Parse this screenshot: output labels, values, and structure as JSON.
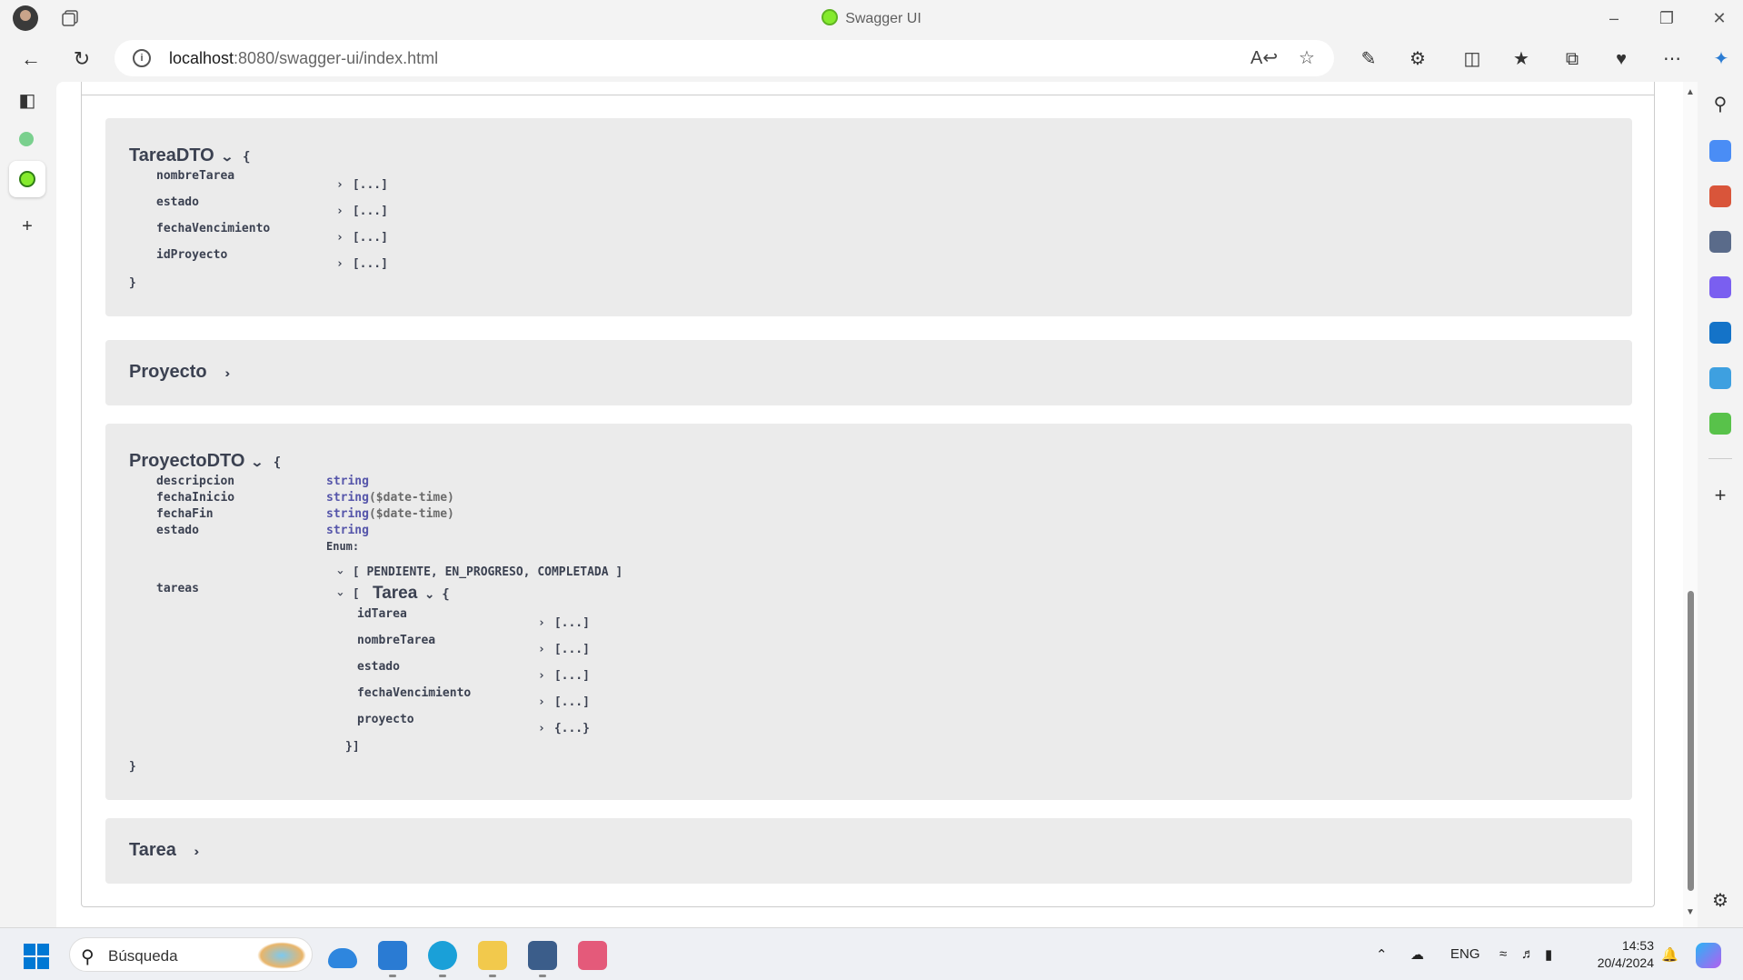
{
  "window": {
    "title": "Swagger UI"
  },
  "address": {
    "host": "localhost",
    "port_path": ":8080/swagger-ui/index.html"
  },
  "models": {
    "tareaDTO": {
      "name": "TareaDTO",
      "open_brace": "{",
      "close_brace": "}",
      "props": [
        {
          "name": "nombreTarea",
          "value": "[...]"
        },
        {
          "name": "estado",
          "value": "[...]"
        },
        {
          "name": "fechaVencimiento",
          "value": "[...]"
        },
        {
          "name": "idProyecto",
          "value": "[...]"
        }
      ]
    },
    "proyecto": {
      "name": "Proyecto"
    },
    "proyectoDTO": {
      "name": "ProyectoDTO",
      "open_brace": "{",
      "close_brace": "}",
      "props": [
        {
          "name": "descripcion",
          "type": "string",
          "format": ""
        },
        {
          "name": "fechaInicio",
          "type": "string",
          "format": "($date-time)"
        },
        {
          "name": "fechaFin",
          "type": "string",
          "format": "($date-time)"
        },
        {
          "name": "estado",
          "type": "string",
          "format": ""
        }
      ],
      "enum_label": "Enum:",
      "enum_values": "[ PENDIENTE, EN_PROGRESO, COMPLETADA ]",
      "tareas": {
        "name": "tareas",
        "open": "[",
        "inner_name": "Tarea",
        "inner_brace": "{",
        "close": "}]",
        "props": [
          {
            "name": "idTarea",
            "value": "[...]"
          },
          {
            "name": "nombreTarea",
            "value": "[...]"
          },
          {
            "name": "estado",
            "value": "[...]"
          },
          {
            "name": "fechaVencimiento",
            "value": "[...]"
          },
          {
            "name": "proyecto",
            "value": "{...}"
          }
        ]
      }
    },
    "tarea": {
      "name": "Tarea"
    }
  },
  "taskbar": {
    "search_placeholder": "Búsqueda",
    "language": "ENG",
    "time": "14:53",
    "date": "20/4/2024"
  }
}
